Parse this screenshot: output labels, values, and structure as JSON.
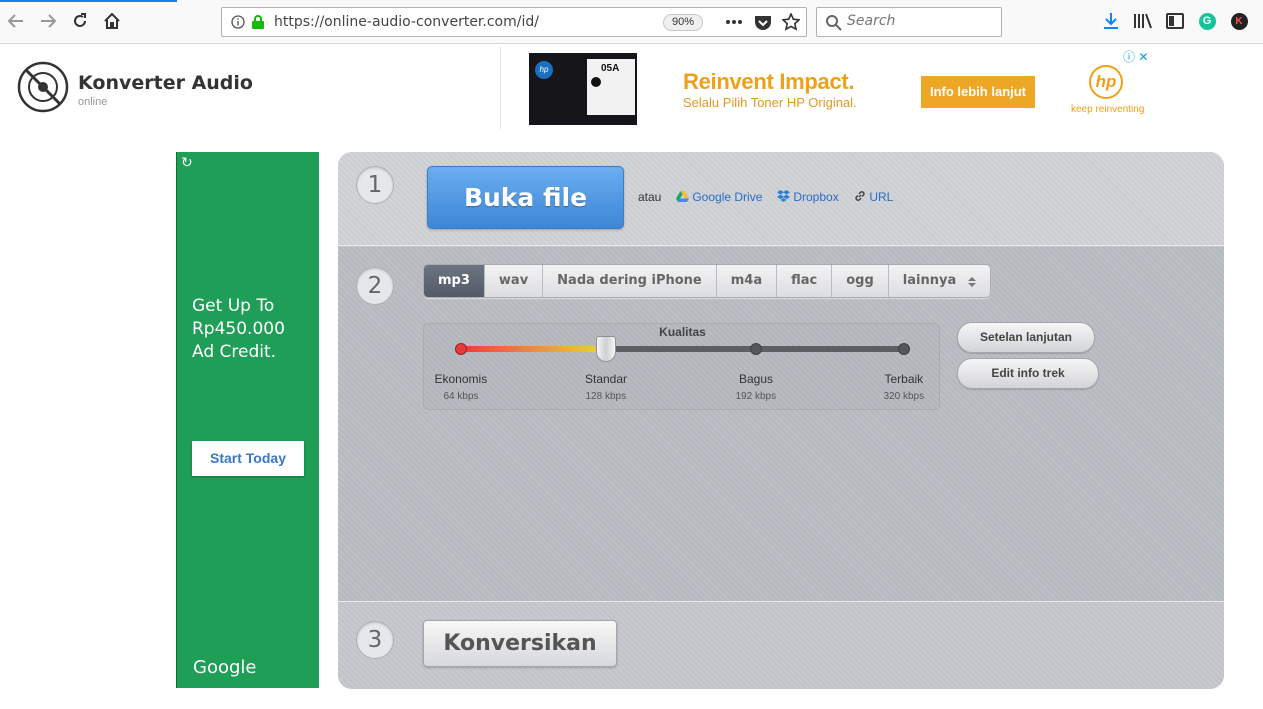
{
  "browser": {
    "url": "https://online-audio-converter.com/id/",
    "zoom": "90%",
    "search_placeholder": "Search",
    "accent": "#0a84ff"
  },
  "header": {
    "title": "Konverter Audio",
    "subtitle": "online",
    "logo_icon": "disc-icon"
  },
  "top_ad": {
    "headline": "Reinvent Impact.",
    "subline": "Selalu Pilih Toner HP Original.",
    "cta": "Info lebih lanjut",
    "brand": "hp",
    "tagline": "keep reinventing",
    "product_label": "05A",
    "accent": "#f0a018"
  },
  "side_ad": {
    "copy_line1": "Get Up To",
    "copy_line2": "Rp450.000",
    "copy_line3": "Ad Credit.",
    "cta": "Start Today",
    "brand": "Google",
    "bg": "#1e9e56"
  },
  "step1": {
    "number": "1",
    "open_label": "Buka file",
    "or_label": "atau",
    "sources": [
      {
        "label": "Google Drive",
        "icon": "google-drive-icon"
      },
      {
        "label": "Dropbox",
        "icon": "dropbox-icon"
      },
      {
        "label": "URL",
        "icon": "link-icon"
      }
    ]
  },
  "step2": {
    "number": "2",
    "formats": [
      "mp3",
      "wav",
      "Nada dering iPhone",
      "m4a",
      "flac",
      "ogg",
      "lainnya"
    ],
    "active_format": "mp3",
    "quality": {
      "label": "Kualitas",
      "levels": [
        {
          "name": "Ekonomis",
          "rate": "64 kbps"
        },
        {
          "name": "Standar",
          "rate": "128 kbps"
        },
        {
          "name": "Bagus",
          "rate": "192 kbps"
        },
        {
          "name": "Terbaik",
          "rate": "320 kbps"
        }
      ],
      "selected_index": 1
    },
    "advanced_label": "Setelan lanjutan",
    "track_info_label": "Edit info trek"
  },
  "step3": {
    "number": "3",
    "convert_label": "Konversikan"
  }
}
